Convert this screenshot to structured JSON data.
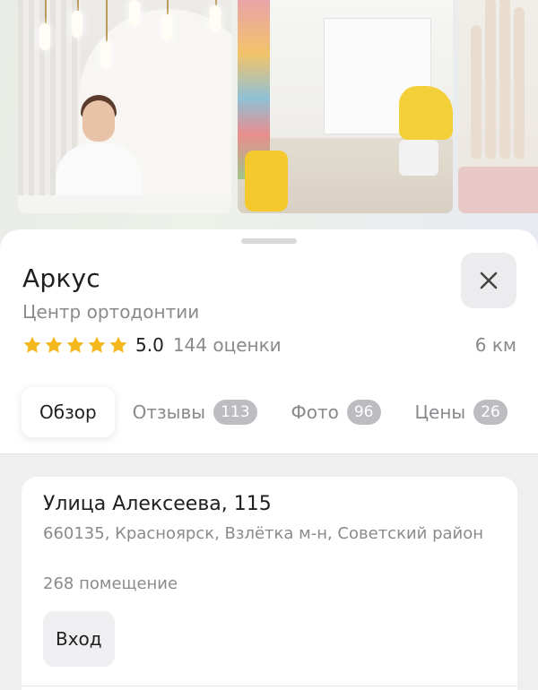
{
  "place": {
    "name": "Аркус",
    "category": "Центр ортодонтии",
    "rating_value": "5.0",
    "rating_stars": 5,
    "rating_count": "144 оценки",
    "distance": "6 км"
  },
  "tabs": [
    {
      "label": "Обзор",
      "badge": null,
      "active": true
    },
    {
      "label": "Отзывы",
      "badge": "113",
      "active": false
    },
    {
      "label": "Фото",
      "badge": "96",
      "active": false
    },
    {
      "label": "Цены",
      "badge": "26",
      "active": false
    }
  ],
  "address": {
    "street": "Улица Алексеева, 115",
    "details": "660135, Красноярск, Взлётка м-н, Советский район",
    "room": "268 помещение",
    "entrance_button": "Вход"
  },
  "colors": {
    "star": "#f5b81c",
    "badge": "#bdbdc1"
  },
  "icons": {
    "close": "close-icon",
    "star": "star-icon"
  }
}
